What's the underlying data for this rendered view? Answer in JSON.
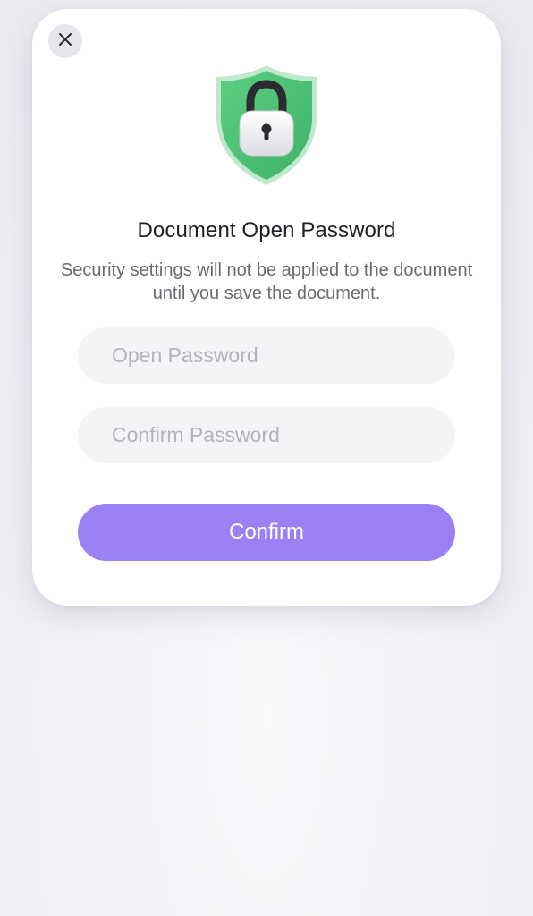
{
  "dialog": {
    "title": "Document Open Password",
    "description": "Security settings will not be applied to the document until you save the document.",
    "open_password_placeholder": "Open Password",
    "open_password_value": "",
    "confirm_password_placeholder": "Confirm Password",
    "confirm_password_value": "",
    "confirm_label": "Confirm",
    "close_icon": "close-icon",
    "hero_icon": "shield-lock-icon"
  },
  "colors": {
    "accent": "#9a80f2",
    "shield_green": "#4cc273",
    "field_bg": "#f4f3f6",
    "placeholder": "#b4b3b9"
  }
}
